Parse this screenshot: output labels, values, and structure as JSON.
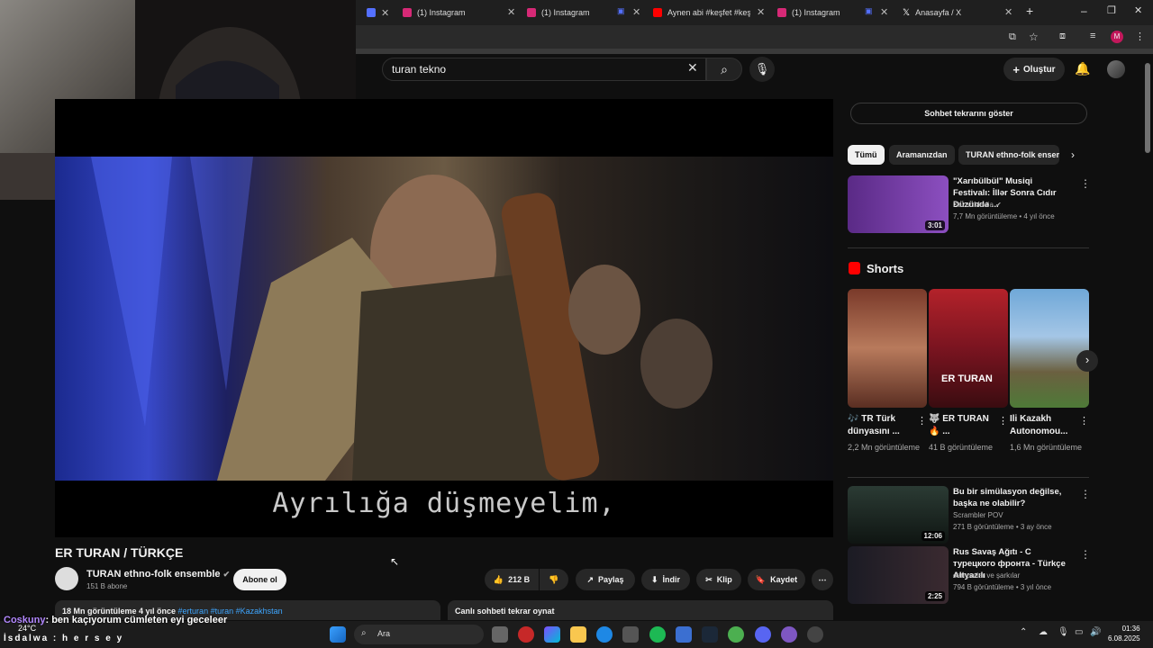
{
  "browser": {
    "tabs": [
      {
        "label": "(1) Instagram",
        "icon": "instagram-icon",
        "color": "#d62976"
      },
      {
        "label": "(1) Instagram",
        "icon": "instagram-icon",
        "color": "#d62976"
      },
      {
        "label": "Aynen abi #keşfet #keşfet",
        "icon": "youtube-icon",
        "color": "#ff0000"
      },
      {
        "label": "(1) Instagram",
        "icon": "instagram-icon",
        "color": "#d62976"
      },
      {
        "label": "Anasayfa / X",
        "icon": "x-icon",
        "color": "#ffffff"
      }
    ],
    "profile_initial": "M"
  },
  "header": {
    "search_value": "turan tekno",
    "create_label": "Oluştur"
  },
  "player": {
    "subtitle": "Ayrılığa düşmeyelim,"
  },
  "video": {
    "title": "ER TURAN / TÜRKÇE",
    "channel": "TURAN ethno-folk ensemble",
    "subscribers": "151 B abone",
    "subscribe_label": "Abone ol",
    "likes": "212 B",
    "share_label": "Paylaş",
    "download_label": "İndir",
    "clip_label": "Klip",
    "save_label": "Kaydet",
    "views_date": "18 Mn görüntüleme  4 yıl önce",
    "tags": "#erturan #turan #Kazakhstan",
    "replay_label": "Canlı sohbeti tekrar oynat"
  },
  "sidebar": {
    "chat_replay_label": "Sohbet tekrarını göster",
    "chips": [
      "Tümü",
      "Aramanızdan",
      "TURAN ethno-folk ensemble"
    ],
    "videos_top": [
      {
        "title": "\"Xarıbülbül\" Musiqi Festivalı: İllər Sonra Cıdır Düzündə ...",
        "channel": "Xazar Media",
        "meta": "7,7 Mn görüntüleme • 4 yıl önce",
        "duration": "3:01"
      }
    ],
    "shorts_title": "Shorts",
    "shorts": [
      {
        "title": "🎶 TR Türk dünyasını ...",
        "views": "2,2 Mn görüntüleme"
      },
      {
        "title": "🐺 ER TURAN 🔥 ...",
        "views": "41 B görüntüleme"
      },
      {
        "title": "Ili Kazakh Autonomou...",
        "views": "1,6 Mn görüntüleme"
      }
    ],
    "short_overlay": "ER TURAN",
    "videos_bottom": [
      {
        "title": "Bu bir simülasyon değilse, başka ne olabilir?",
        "channel": "Scrambler POV",
        "meta": "271 B görüntüleme • 3 ay önce",
        "duration": "12:06"
      },
      {
        "title": "Rus Savaş Ağıtı - С турецкого фронта - Türkçe Altyazılı",
        "channel": "can patlar ve şarkılar",
        "meta": "794 B görüntüleme • 3 yıl önce",
        "duration": "2:25"
      }
    ]
  },
  "stream_overlay": {
    "chat_user": "Coskuny",
    "chat_message": ": ben kaçıyorum cümleten eyi geceleer",
    "bottom_text": "İsdalwa : h e r s e y",
    "weather": "24°C"
  },
  "taskbar": {
    "search_placeholder": "Ara",
    "time": "01:36",
    "date": "6.08.2025"
  }
}
